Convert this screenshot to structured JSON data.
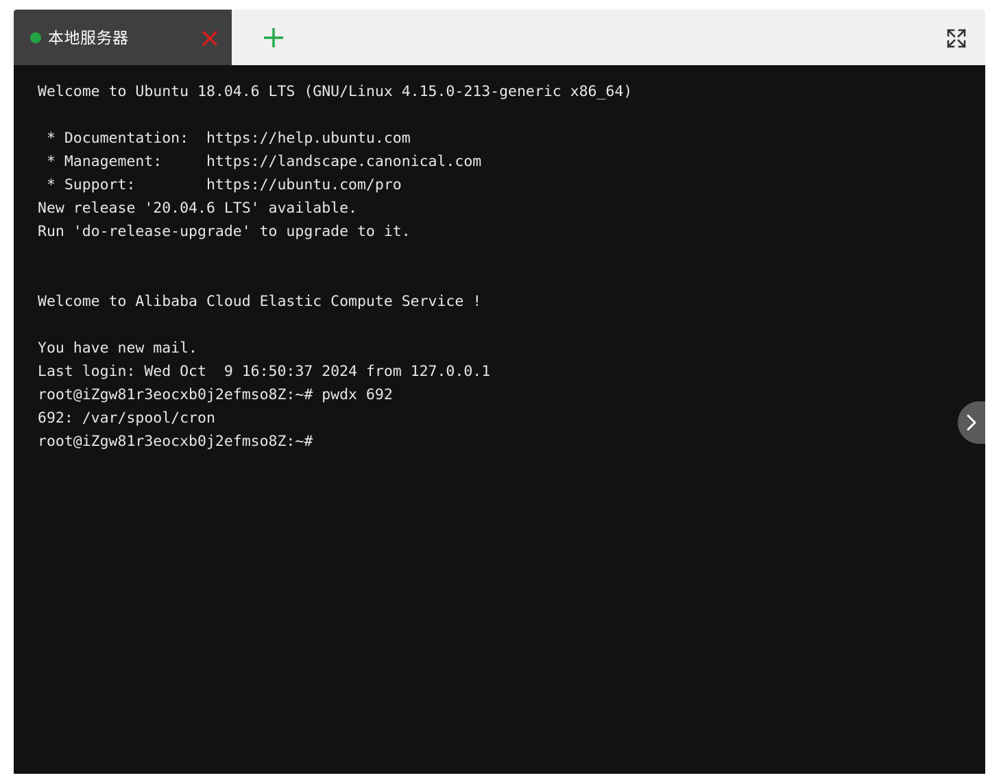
{
  "window": {
    "header": {
      "tabs": [
        {
          "label": "本地服务器",
          "status": "connected",
          "status_color": "#25a244",
          "close_label": "×"
        }
      ],
      "new_tab_label": "+",
      "new_tab_color": "#22a84a",
      "close_color": "#e01b1b",
      "fullscreen_label": "全屏"
    },
    "terminal": {
      "prompt": "root@iZgw81r3eocxb0j2efmso8Z:~#",
      "hostname": "iZgw81r3eocxb0j2efmso8Z",
      "user": "root",
      "last_command": "pwdx 692",
      "command_output": "692: /var/spool/cron",
      "background_color": "#121212",
      "text_color": "#e8e8e8",
      "content": "Welcome to Ubuntu 18.04.6 LTS (GNU/Linux 4.15.0-213-generic x86_64)\n\n * Documentation:  https://help.ubuntu.com\n * Management:     https://landscape.canonical.com\n * Support:        https://ubuntu.com/pro\nNew release '20.04.6 LTS' available.\nRun 'do-release-upgrade' to upgrade to it.\n\n\nWelcome to Alibaba Cloud Elastic Compute Service !\n\nYou have new mail.\nLast login: Wed Oct  9 16:50:37 2024 from 127.0.0.1\nroot@iZgw81r3eocxb0j2efmso8Z:~# pwdx 692\n692: /var/spool/cron\nroot@iZgw81r3eocxb0j2efmso8Z:~# "
    },
    "drawer": {
      "toggle_label": "›"
    }
  }
}
